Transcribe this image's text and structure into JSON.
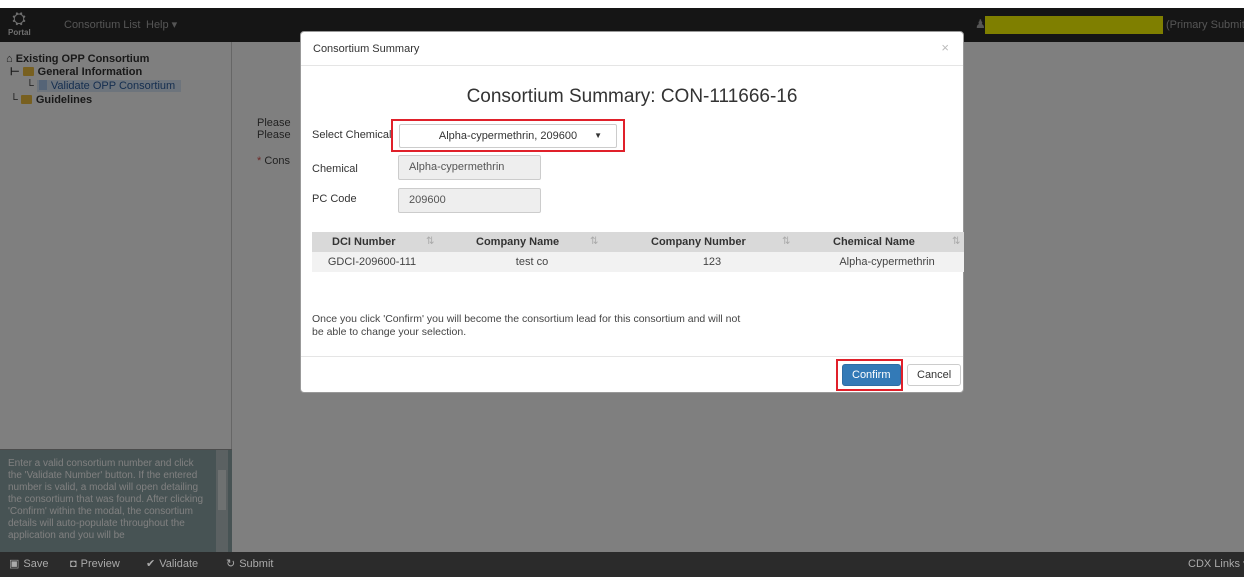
{
  "app": {
    "logo_text": "Portal",
    "nav": [
      "Consortium List",
      "Help ▾"
    ],
    "user_role": "(Primary Submitter)"
  },
  "sidebar": {
    "tree": {
      "root": "Existing OPP Consortium",
      "general": "General Information",
      "validate": "Validate OPP Consortium",
      "guidelines": "Guidelines"
    },
    "help_text": "Enter a valid consortium number and click the 'Validate Number' button. If the entered number is valid, a modal will open detailing the consortium that was found. After clicking 'Confirm' within the modal, the consortium details will auto-populate throughout the application and you will be"
  },
  "page": {
    "line1": "Please",
    "line2": "Please",
    "required_label": "Cons"
  },
  "modal": {
    "title": "Consortium Summary",
    "close": "×",
    "heading": "Consortium Summary: CON-111666-16",
    "select_label": "Select Chemical",
    "select_value": "Alpha-cypermethrin, 209600",
    "chemical_label": "Chemical",
    "chemical_value": "Alpha-cypermethrin",
    "pc_code_label": "PC Code",
    "pc_code_value": "209600",
    "table": {
      "headers": [
        "DCI Number",
        "Company Name",
        "Company Number",
        "Chemical Name"
      ],
      "rows": [
        [
          "GDCI-209600-111",
          "test co",
          "123",
          "Alpha-cypermethrin"
        ]
      ]
    },
    "note": "Once you click 'Confirm' you will become the consortium lead for this consortium and will not be able to change your selection.",
    "confirm": "Confirm",
    "cancel": "Cancel"
  },
  "bottom": {
    "save": "Save",
    "preview": "Preview",
    "validate": "Validate",
    "submit": "Submit",
    "cdx_links": "CDX Links ▾"
  },
  "colors": {
    "highlight": "#ffff00",
    "callout": "#e0202a",
    "primary": "#337ab7"
  }
}
